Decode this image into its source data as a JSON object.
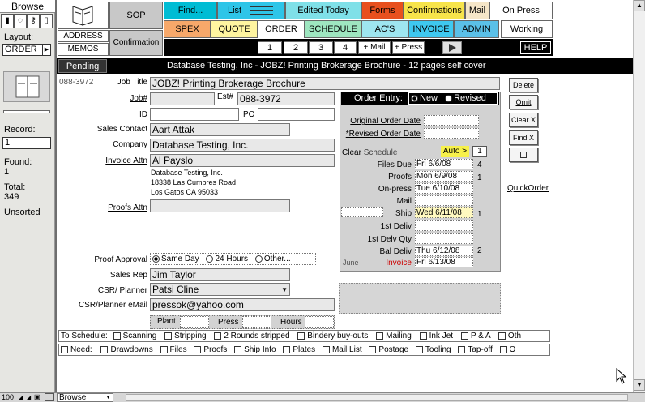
{
  "sidebar": {
    "mode": "Browse",
    "layout_label": "Layout:",
    "layout_value": "ORDER",
    "record_label": "Record:",
    "record_value": "1",
    "found_label": "Found:",
    "found_value": "1",
    "total_label": "Total:",
    "total_value": "349",
    "sort_status": "Unsorted"
  },
  "nav": {
    "sop": "SOP",
    "address": "ADDRESS",
    "memos": "MEMOS",
    "confirmation": "Confirmation",
    "find": "Find...",
    "list": "List",
    "edited_today": "Edited Today",
    "forms": "Forms",
    "confirmations": "Confirmations",
    "mail": "Mail",
    "on_press": "On Press",
    "spex": "SPEX",
    "quote": "QUOTE",
    "order": "ORDER",
    "schedule": "SCHEDULE",
    "acs": "AC'S",
    "invoice": "INVOICE",
    "admin": "ADMIN",
    "working": "Working",
    "page1": "1",
    "page2": "2",
    "page3": "3",
    "page4": "4",
    "plus_mail": "+ Mail",
    "plus_press": "+ Press",
    "help": "HELP"
  },
  "header": {
    "status": "Pending",
    "title": "Database Testing, Inc  -  JOBZ! Printing Brokerage Brochure  -  12 pages self cover"
  },
  "form": {
    "job_number": "088-3972",
    "job_title_label": "Job Title",
    "job_title": "JOBZ! Printing Brokerage Brochure",
    "job_label": "Job#",
    "est_label": "Est#",
    "est_value": "088-3972",
    "id_label": "ID",
    "po_label": "PO",
    "sales_contact_label": "Sales Contact",
    "sales_contact": "Aart Attak",
    "company_label": "Company",
    "company": "Database Testing, Inc.",
    "invoice_attn_label": "Invoice Attn",
    "invoice_attn": "Al Payslo",
    "address_line1": "Database Testing, Inc.",
    "address_line2": "18338 Las Cumbres Road",
    "address_line3": "Los Gatos  CA  95033",
    "proofs_attn_label": "Proofs Attn",
    "proof_approval_label": "Proof Approval",
    "proof_same_day": "Same Day",
    "proof_24_hours": "24 Hours",
    "proof_other": "Other...",
    "sales_rep_label": "Sales Rep",
    "sales_rep": "Jim Taylor",
    "csr_label": "CSR/ Planner",
    "csr": "Patsi Cline",
    "csr_email_label": "CSR/Planner eMail",
    "csr_email": "pressok@yahoo.com",
    "plant_label": "Plant",
    "press_label": "Press",
    "hours_label": "Hours"
  },
  "order_entry": {
    "label": "Order Entry:",
    "new": "New",
    "revised": "Revised",
    "original_date_label": "Original Order Date",
    "revised_date_label": "*Revised Order Date",
    "clear": "Clear",
    "schedule": "Schedule",
    "auto": "Auto >",
    "auto_num": "1",
    "files_due_label": "Files Due",
    "files_due": "Fri 6/6/08",
    "files_due_n": "4",
    "proofs_label": "Proofs",
    "proofs": "Mon 6/9/08",
    "proofs_n": "1",
    "onpress_label": "On-press",
    "onpress": "Tue 6/10/08",
    "mail_label": "Mail",
    "ship_label": "Ship",
    "ship": "Wed 6/11/08",
    "ship_n": "1",
    "first_deliv_label": "1st Deliv",
    "first_deliv_qty_label": "1st Delv Qty",
    "bal_deliv_label": "Bal Deliv",
    "bal_deliv": "Thu 6/12/08",
    "bal_deliv_n": "2",
    "june": "June",
    "invoice_label": "Invoice",
    "invoice_date": "Fri 6/13/08"
  },
  "side_buttons": {
    "delete": "Delete",
    "omit": "Omit",
    "clear_x": "Clear X",
    "find_x": "Find X",
    "quick_order": "QuickOrder"
  },
  "to_schedule": {
    "label": "To Schedule:",
    "items": [
      "Scanning",
      "Stripping",
      "2 Rounds stripped",
      "Bindery buy-outs",
      "Mailing",
      "Ink Jet",
      "P & A",
      "Oth"
    ]
  },
  "need": {
    "label": "Need:",
    "items": [
      "Drawdowns",
      "Files",
      "Proofs",
      "Ship Info",
      "Plates",
      "Mail List",
      "Postage",
      "Tooling",
      "Tap-off",
      "O"
    ]
  },
  "status": {
    "zoom": "100",
    "mode": "Browse"
  },
  "colors": {
    "find": "#00bcd4",
    "list": "#2ec5e8",
    "edited": "#7fe0e8",
    "forms": "#e8501e",
    "confirmations": "#f7e44a",
    "mail": "#f5e6c8",
    "spex": "#f7a86a",
    "quote": "#fff5a0",
    "schedule": "#9ee6c0",
    "acs": "#9ee6f0",
    "invoice": "#3ec8f0",
    "admin": "#5ac0e8"
  }
}
